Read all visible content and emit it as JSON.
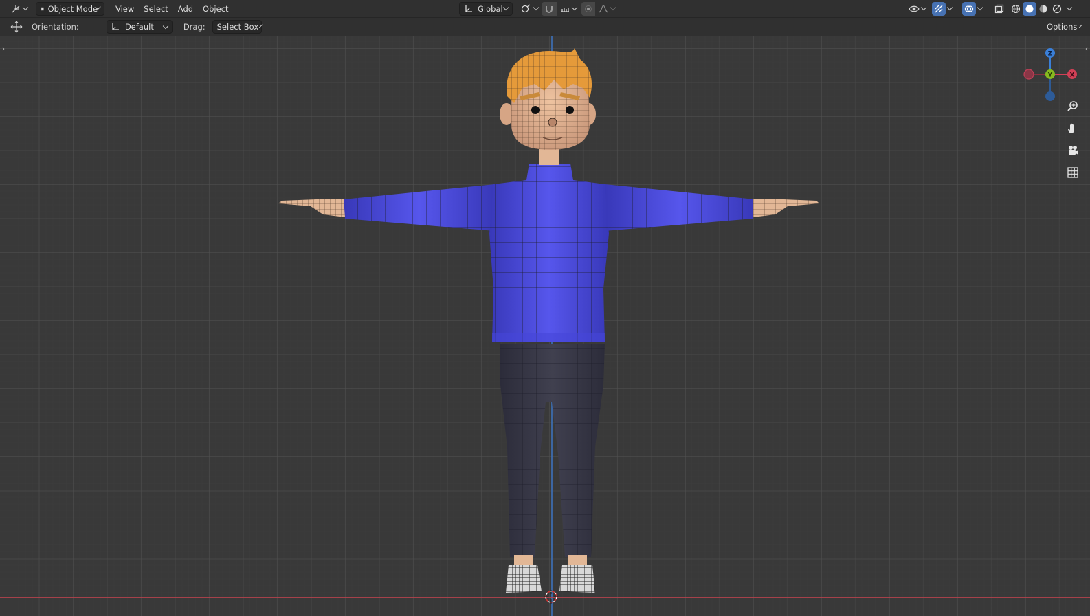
{
  "header": {
    "mode_label": "Object Mode",
    "menus": [
      "View",
      "Select",
      "Add",
      "Object"
    ],
    "transform_orientation": "Global",
    "options_label": "Options"
  },
  "tool_settings": {
    "orientation_label": "Orientation:",
    "orientation_value": "Default",
    "drag_label": "Drag:",
    "drag_value": "Select Box"
  },
  "gizmo": {
    "z_label": "Z",
    "y_label": "Y",
    "x_label": "X",
    "colors": {
      "x": "#d24056",
      "y": "#86b91f",
      "z": "#3a7fd8"
    }
  },
  "colors": {
    "sweater": "#4a4ae0",
    "pants": "#3a3a4c",
    "skin": "#e2b796",
    "hair": "#e59a3a",
    "grid_bg": "#393939"
  }
}
